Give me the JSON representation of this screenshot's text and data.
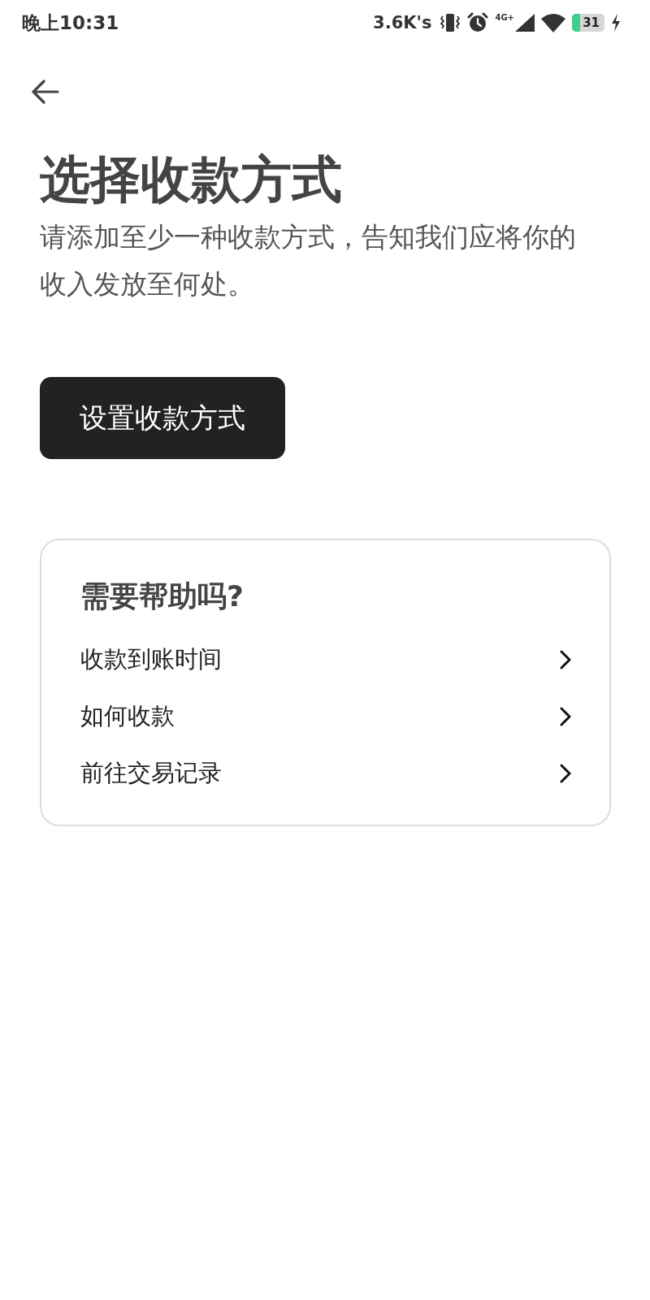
{
  "status_bar": {
    "time": "晚上10:31",
    "net_speed": "3.6K's",
    "network": "4G+",
    "battery": "31"
  },
  "title": "选择收款方式",
  "subtitle": "请添加至少一种收款方式，告知我们应将你的收入发放至何处。",
  "primary_button": "设置收款方式",
  "help_card": {
    "title": "需要帮助吗?",
    "items": [
      {
        "label": "收款到账时间"
      },
      {
        "label": "如何收款"
      },
      {
        "label": "前往交易记录"
      }
    ]
  }
}
